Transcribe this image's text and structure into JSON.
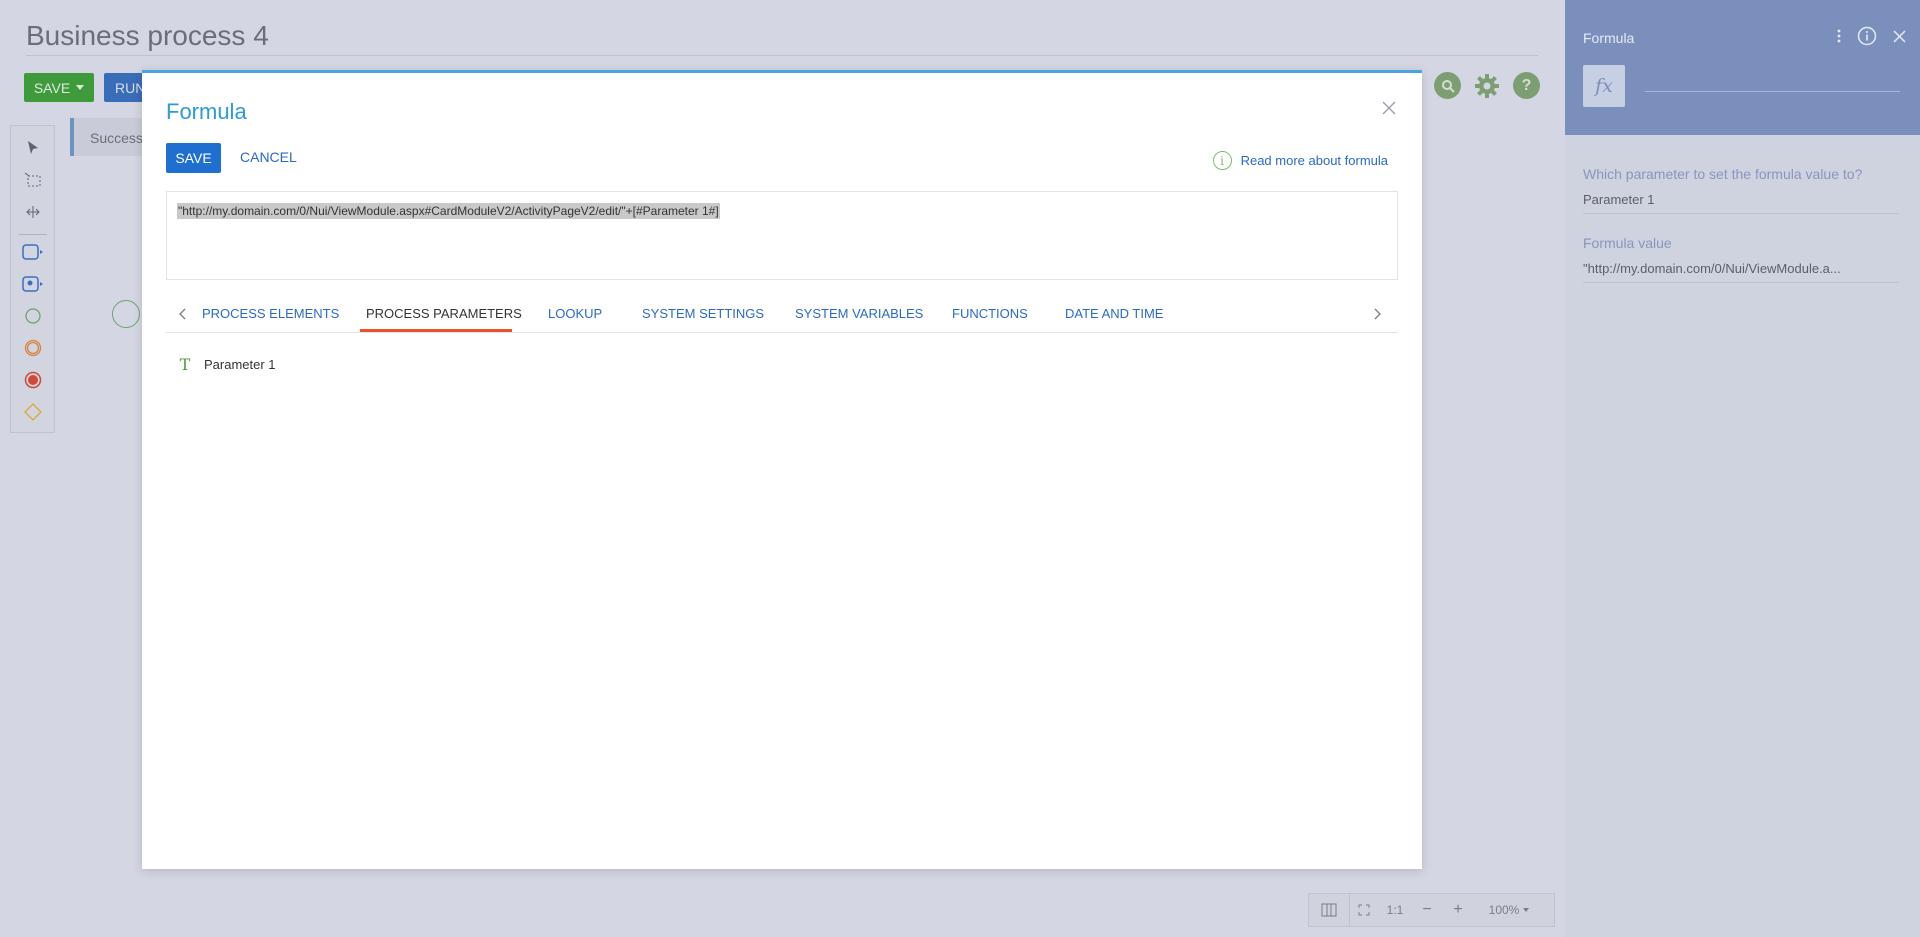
{
  "designer": {
    "title": "Business process 4",
    "save_label": "SAVE",
    "run_label": "RUN",
    "toast_text": "Successfully saved",
    "zoom": {
      "ratio_label": "1:1",
      "minus": "−",
      "plus": "+",
      "level": "100%"
    }
  },
  "panel": {
    "title": "Formula",
    "fx_symbol": "fx",
    "param_label": "Which parameter to set the formula value to?",
    "param_value": "Parameter 1",
    "formula_label": "Formula value",
    "formula_value": "\"http://my.domain.com/0/Nui/ViewModule.a..."
  },
  "modal": {
    "title": "Formula",
    "save_label": "SAVE",
    "cancel_label": "CANCEL",
    "read_more_label": "Read more about formula",
    "info_glyph": "i",
    "formula_text": "\"http://my.domain.com/0/Nui/ViewModule.aspx#CardModuleV2/ActivityPageV2/edit/\"+[#Parameter 1#]",
    "tabs": [
      {
        "label": "PROCESS ELEMENTS"
      },
      {
        "label": "PROCESS PARAMETERS"
      },
      {
        "label": "LOOKUP"
      },
      {
        "label": "SYSTEM SETTINGS"
      },
      {
        "label": "SYSTEM VARIABLES"
      },
      {
        "label": "FUNCTIONS"
      },
      {
        "label": "DATE AND TIME"
      }
    ],
    "active_tab": "PROCESS PARAMETERS",
    "params": [
      {
        "type_glyph": "T",
        "name": "Parameter 1"
      }
    ]
  },
  "colors": {
    "accent": "#2c9bd6",
    "primary_button": "#1f6fd0",
    "active_tab_underline": "#e8542c",
    "panel_header": "#7b8fbd"
  }
}
